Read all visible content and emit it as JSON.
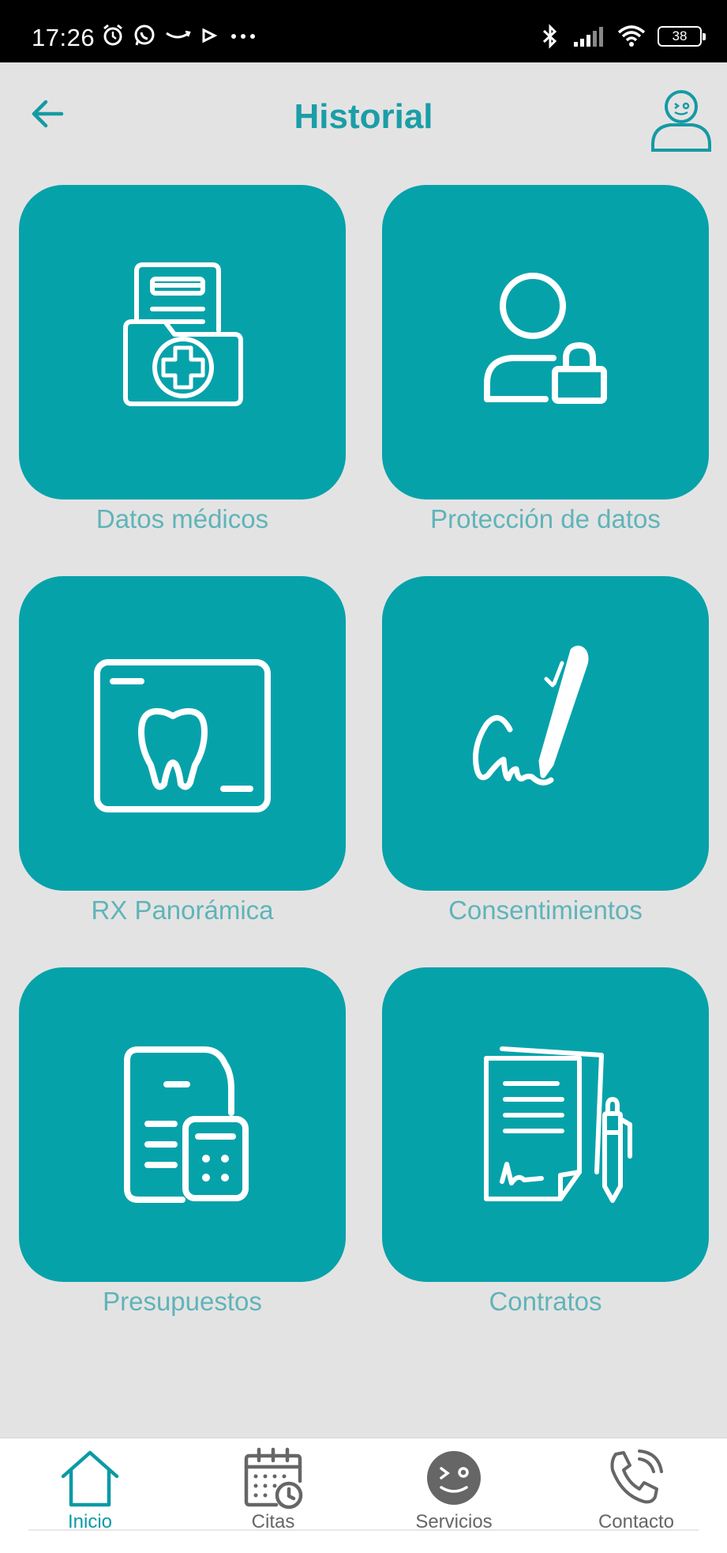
{
  "status_bar": {
    "time": "17:26",
    "left_icons": [
      "alarm-icon",
      "whatsapp-icon",
      "amazon-icon",
      "play-icon",
      "more-dots-icon"
    ],
    "right_icons": [
      "bluetooth-icon",
      "signal-icon",
      "wifi-icon",
      "battery-icon"
    ],
    "battery_level": "38"
  },
  "header": {
    "title": "Historial",
    "back_icon": "arrow-left-icon",
    "profile_icon": "user-profile-icon"
  },
  "colors": {
    "accent": "#06a2aa",
    "title": "#1a9ea7",
    "label": "#5fb4b9",
    "background": "#e4e3e3"
  },
  "tiles": [
    {
      "label": "Datos médicos",
      "icon": "medical-folder-icon"
    },
    {
      "label": "Protección de datos",
      "icon": "user-lock-icon"
    },
    {
      "label": "RX Panorámica",
      "icon": "tooth-xray-icon"
    },
    {
      "label": "Consentimientos",
      "icon": "signature-pen-icon"
    },
    {
      "label": "Presupuestos",
      "icon": "document-calculator-icon"
    },
    {
      "label": "Contratos",
      "icon": "contract-pen-icon"
    }
  ],
  "bottom_nav": [
    {
      "label": "Inicio",
      "icon": "home-icon",
      "active": true
    },
    {
      "label": "Citas",
      "icon": "calendar-clock-icon",
      "active": false
    },
    {
      "label": "Servicios",
      "icon": "smiley-face-icon",
      "active": false
    },
    {
      "label": "Contacto",
      "icon": "phone-icon",
      "active": false
    }
  ]
}
